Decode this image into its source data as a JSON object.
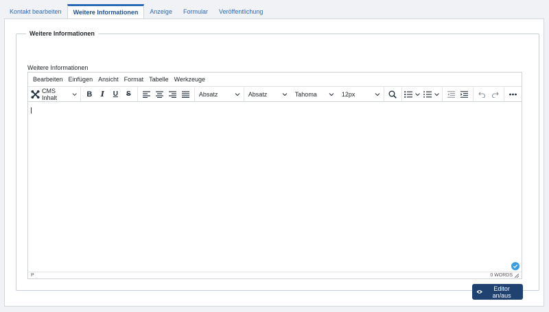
{
  "tabs": [
    {
      "label": "Kontakt bearbeiten"
    },
    {
      "label": "Weitere Informationen",
      "active": true
    },
    {
      "label": "Anzeige"
    },
    {
      "label": "Formular"
    },
    {
      "label": "Veröffentlichung"
    }
  ],
  "fieldset": {
    "legend": "Weitere Informationen",
    "field_label": "Weitere Informationen"
  },
  "editor": {
    "menu": [
      "Bearbeiten",
      "Einfügen",
      "Ansicht",
      "Format",
      "Tabelle",
      "Werkzeuge"
    ],
    "toolbar": {
      "cms_label": "CMS Inhalt",
      "bold": "B",
      "italic": "I",
      "underline": "U",
      "strike": "S",
      "block_format": "Absatz",
      "style_format": "Absatz",
      "font_family": "Tahoma",
      "font_size": "12px"
    },
    "statusbar": {
      "path": "P",
      "word_count": "0 WORDS"
    }
  },
  "toggle_button": {
    "label": "Editor an/aus"
  },
  "colors": {
    "accent": "#2a69b8",
    "button_bg": "#1f4270",
    "check": "#3a9de0"
  }
}
